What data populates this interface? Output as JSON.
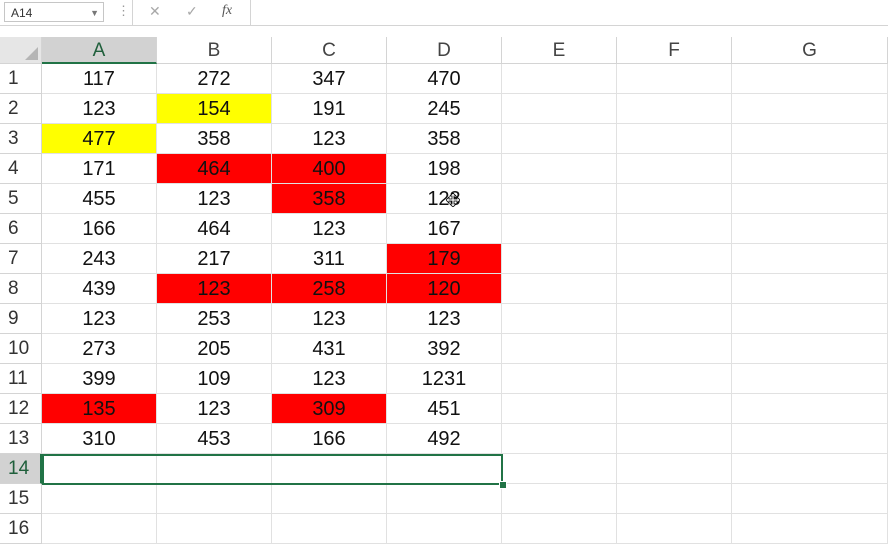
{
  "namebox": {
    "value": "A14"
  },
  "formula_bar": {
    "cancel_icon": "✕",
    "enter_icon": "✓",
    "fx_icon": "fx",
    "value": ""
  },
  "colors": {
    "yellow": "#ffff00",
    "red": "#ff0000",
    "selection": "#217346"
  },
  "columns": [
    "A",
    "B",
    "C",
    "D",
    "E",
    "F",
    "G"
  ],
  "selected_cell": "A14",
  "rows": [
    {
      "num": "1",
      "cells": [
        "117",
        "272",
        "347",
        "470"
      ],
      "fills": [
        "",
        "",
        "",
        ""
      ]
    },
    {
      "num": "2",
      "cells": [
        "123",
        "154",
        "191",
        "245"
      ],
      "fills": [
        "",
        "yellow",
        "",
        ""
      ]
    },
    {
      "num": "3",
      "cells": [
        "477",
        "358",
        "123",
        "358"
      ],
      "fills": [
        "yellow",
        "",
        "",
        ""
      ]
    },
    {
      "num": "4",
      "cells": [
        "171",
        "464",
        "400",
        "198"
      ],
      "fills": [
        "",
        "red",
        "red",
        ""
      ]
    },
    {
      "num": "5",
      "cells": [
        "455",
        "123",
        "358",
        "123"
      ],
      "fills": [
        "",
        "",
        "red",
        ""
      ]
    },
    {
      "num": "6",
      "cells": [
        "166",
        "464",
        "123",
        "167"
      ],
      "fills": [
        "",
        "",
        "",
        ""
      ]
    },
    {
      "num": "7",
      "cells": [
        "243",
        "217",
        "311",
        "179"
      ],
      "fills": [
        "",
        "",
        "",
        "red"
      ]
    },
    {
      "num": "8",
      "cells": [
        "439",
        "123",
        "258",
        "120"
      ],
      "fills": [
        "",
        "red",
        "red",
        "red"
      ]
    },
    {
      "num": "9",
      "cells": [
        "123",
        "253",
        "123",
        "123"
      ],
      "fills": [
        "",
        "",
        "",
        ""
      ]
    },
    {
      "num": "10",
      "cells": [
        "273",
        "205",
        "431",
        "392"
      ],
      "fills": [
        "",
        "",
        "",
        ""
      ]
    },
    {
      "num": "11",
      "cells": [
        "399",
        "109",
        "123",
        "1231"
      ],
      "fills": [
        "",
        "",
        "",
        ""
      ]
    },
    {
      "num": "12",
      "cells": [
        "135",
        "123",
        "309",
        "451"
      ],
      "fills": [
        "red",
        "",
        "red",
        ""
      ]
    },
    {
      "num": "13",
      "cells": [
        "310",
        "453",
        "166",
        "492"
      ],
      "fills": [
        "",
        "",
        "",
        ""
      ]
    },
    {
      "num": "14",
      "cells": [
        "",
        "",
        "",
        ""
      ],
      "fills": [
        "",
        "",
        "",
        ""
      ]
    },
    {
      "num": "15",
      "cells": [
        "",
        "",
        "",
        ""
      ],
      "fills": [
        "",
        "",
        "",
        ""
      ]
    },
    {
      "num": "16",
      "cells": [
        "",
        "",
        "",
        ""
      ],
      "fills": [
        "",
        "",
        "",
        ""
      ]
    }
  ]
}
